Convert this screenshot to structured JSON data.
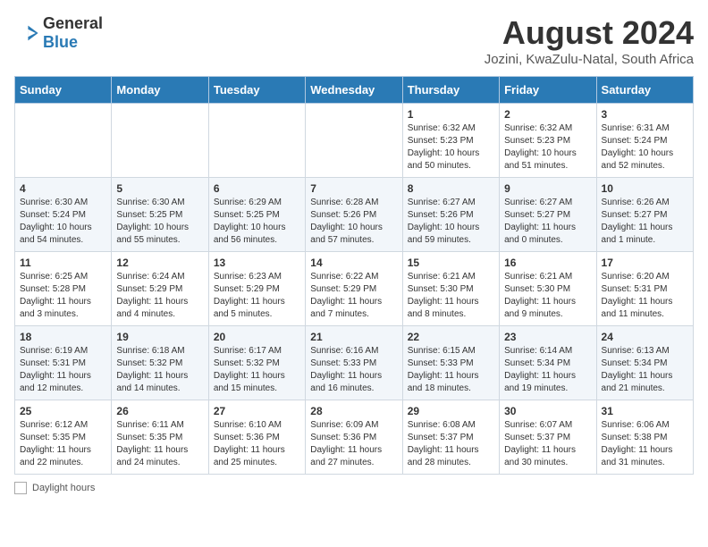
{
  "header": {
    "logo_general": "General",
    "logo_blue": "Blue",
    "title": "August 2024",
    "subtitle": "Jozini, KwaZulu-Natal, South Africa"
  },
  "days_of_week": [
    "Sunday",
    "Monday",
    "Tuesday",
    "Wednesday",
    "Thursday",
    "Friday",
    "Saturday"
  ],
  "weeks": [
    [
      {
        "day": "",
        "info": ""
      },
      {
        "day": "",
        "info": ""
      },
      {
        "day": "",
        "info": ""
      },
      {
        "day": "",
        "info": ""
      },
      {
        "day": "1",
        "info": "Sunrise: 6:32 AM\nSunset: 5:23 PM\nDaylight: 10 hours and 50 minutes."
      },
      {
        "day": "2",
        "info": "Sunrise: 6:32 AM\nSunset: 5:23 PM\nDaylight: 10 hours and 51 minutes."
      },
      {
        "day": "3",
        "info": "Sunrise: 6:31 AM\nSunset: 5:24 PM\nDaylight: 10 hours and 52 minutes."
      }
    ],
    [
      {
        "day": "4",
        "info": "Sunrise: 6:30 AM\nSunset: 5:24 PM\nDaylight: 10 hours and 54 minutes."
      },
      {
        "day": "5",
        "info": "Sunrise: 6:30 AM\nSunset: 5:25 PM\nDaylight: 10 hours and 55 minutes."
      },
      {
        "day": "6",
        "info": "Sunrise: 6:29 AM\nSunset: 5:25 PM\nDaylight: 10 hours and 56 minutes."
      },
      {
        "day": "7",
        "info": "Sunrise: 6:28 AM\nSunset: 5:26 PM\nDaylight: 10 hours and 57 minutes."
      },
      {
        "day": "8",
        "info": "Sunrise: 6:27 AM\nSunset: 5:26 PM\nDaylight: 10 hours and 59 minutes."
      },
      {
        "day": "9",
        "info": "Sunrise: 6:27 AM\nSunset: 5:27 PM\nDaylight: 11 hours and 0 minutes."
      },
      {
        "day": "10",
        "info": "Sunrise: 6:26 AM\nSunset: 5:27 PM\nDaylight: 11 hours and 1 minute."
      }
    ],
    [
      {
        "day": "11",
        "info": "Sunrise: 6:25 AM\nSunset: 5:28 PM\nDaylight: 11 hours and 3 minutes."
      },
      {
        "day": "12",
        "info": "Sunrise: 6:24 AM\nSunset: 5:29 PM\nDaylight: 11 hours and 4 minutes."
      },
      {
        "day": "13",
        "info": "Sunrise: 6:23 AM\nSunset: 5:29 PM\nDaylight: 11 hours and 5 minutes."
      },
      {
        "day": "14",
        "info": "Sunrise: 6:22 AM\nSunset: 5:29 PM\nDaylight: 11 hours and 7 minutes."
      },
      {
        "day": "15",
        "info": "Sunrise: 6:21 AM\nSunset: 5:30 PM\nDaylight: 11 hours and 8 minutes."
      },
      {
        "day": "16",
        "info": "Sunrise: 6:21 AM\nSunset: 5:30 PM\nDaylight: 11 hours and 9 minutes."
      },
      {
        "day": "17",
        "info": "Sunrise: 6:20 AM\nSunset: 5:31 PM\nDaylight: 11 hours and 11 minutes."
      }
    ],
    [
      {
        "day": "18",
        "info": "Sunrise: 6:19 AM\nSunset: 5:31 PM\nDaylight: 11 hours and 12 minutes."
      },
      {
        "day": "19",
        "info": "Sunrise: 6:18 AM\nSunset: 5:32 PM\nDaylight: 11 hours and 14 minutes."
      },
      {
        "day": "20",
        "info": "Sunrise: 6:17 AM\nSunset: 5:32 PM\nDaylight: 11 hours and 15 minutes."
      },
      {
        "day": "21",
        "info": "Sunrise: 6:16 AM\nSunset: 5:33 PM\nDaylight: 11 hours and 16 minutes."
      },
      {
        "day": "22",
        "info": "Sunrise: 6:15 AM\nSunset: 5:33 PM\nDaylight: 11 hours and 18 minutes."
      },
      {
        "day": "23",
        "info": "Sunrise: 6:14 AM\nSunset: 5:34 PM\nDaylight: 11 hours and 19 minutes."
      },
      {
        "day": "24",
        "info": "Sunrise: 6:13 AM\nSunset: 5:34 PM\nDaylight: 11 hours and 21 minutes."
      }
    ],
    [
      {
        "day": "25",
        "info": "Sunrise: 6:12 AM\nSunset: 5:35 PM\nDaylight: 11 hours and 22 minutes."
      },
      {
        "day": "26",
        "info": "Sunrise: 6:11 AM\nSunset: 5:35 PM\nDaylight: 11 hours and 24 minutes."
      },
      {
        "day": "27",
        "info": "Sunrise: 6:10 AM\nSunset: 5:36 PM\nDaylight: 11 hours and 25 minutes."
      },
      {
        "day": "28",
        "info": "Sunrise: 6:09 AM\nSunset: 5:36 PM\nDaylight: 11 hours and 27 minutes."
      },
      {
        "day": "29",
        "info": "Sunrise: 6:08 AM\nSunset: 5:37 PM\nDaylight: 11 hours and 28 minutes."
      },
      {
        "day": "30",
        "info": "Sunrise: 6:07 AM\nSunset: 5:37 PM\nDaylight: 11 hours and 30 minutes."
      },
      {
        "day": "31",
        "info": "Sunrise: 6:06 AM\nSunset: 5:38 PM\nDaylight: 11 hours and 31 minutes."
      }
    ]
  ],
  "footer": {
    "daylight_label": "Daylight hours"
  }
}
